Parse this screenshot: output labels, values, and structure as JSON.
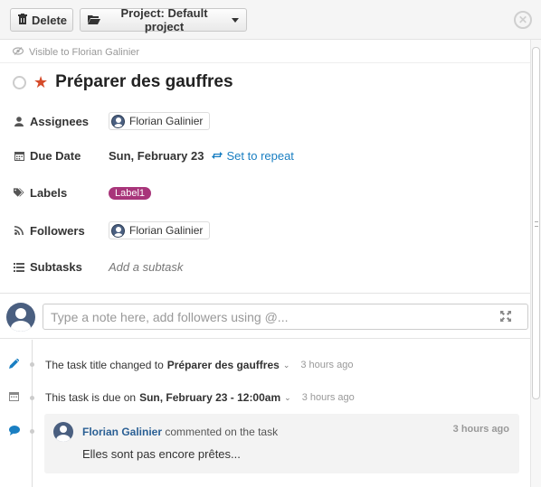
{
  "toolbar": {
    "delete_label": "Delete",
    "project_label": "Project: Default project"
  },
  "visibility_text": "Visible to Florian Galinier",
  "task": {
    "title": "Préparer des gauffres",
    "star_color": "#d54b2a"
  },
  "fields": {
    "assignees": {
      "label": "Assignees",
      "user": "Florian Galinier"
    },
    "due_date": {
      "label": "Due Date",
      "value": "Sun, February 23",
      "repeat_link": "Set to repeat"
    },
    "labels": {
      "label": "Labels",
      "value": "Label1",
      "color": "#a8357a"
    },
    "followers": {
      "label": "Followers",
      "user": "Florian Galinier"
    },
    "subtasks": {
      "label": "Subtasks",
      "placeholder": "Add a subtask"
    }
  },
  "note_input": {
    "placeholder": "Type a note here, add followers using @..."
  },
  "activity": [
    {
      "icon": "pencil-icon",
      "prefix": "The task title changed to",
      "bold": "Préparer des gauffres",
      "time": "3 hours ago"
    },
    {
      "icon": "calendar-icon",
      "prefix": "This task is due on",
      "bold": "Sun, February 23 - 12:00am",
      "time": "3 hours ago"
    }
  ],
  "comment": {
    "author": "Florian Galinier",
    "action": "commented on the task",
    "time": "3 hours ago",
    "body": "Elles sont pas encore prêtes..."
  }
}
